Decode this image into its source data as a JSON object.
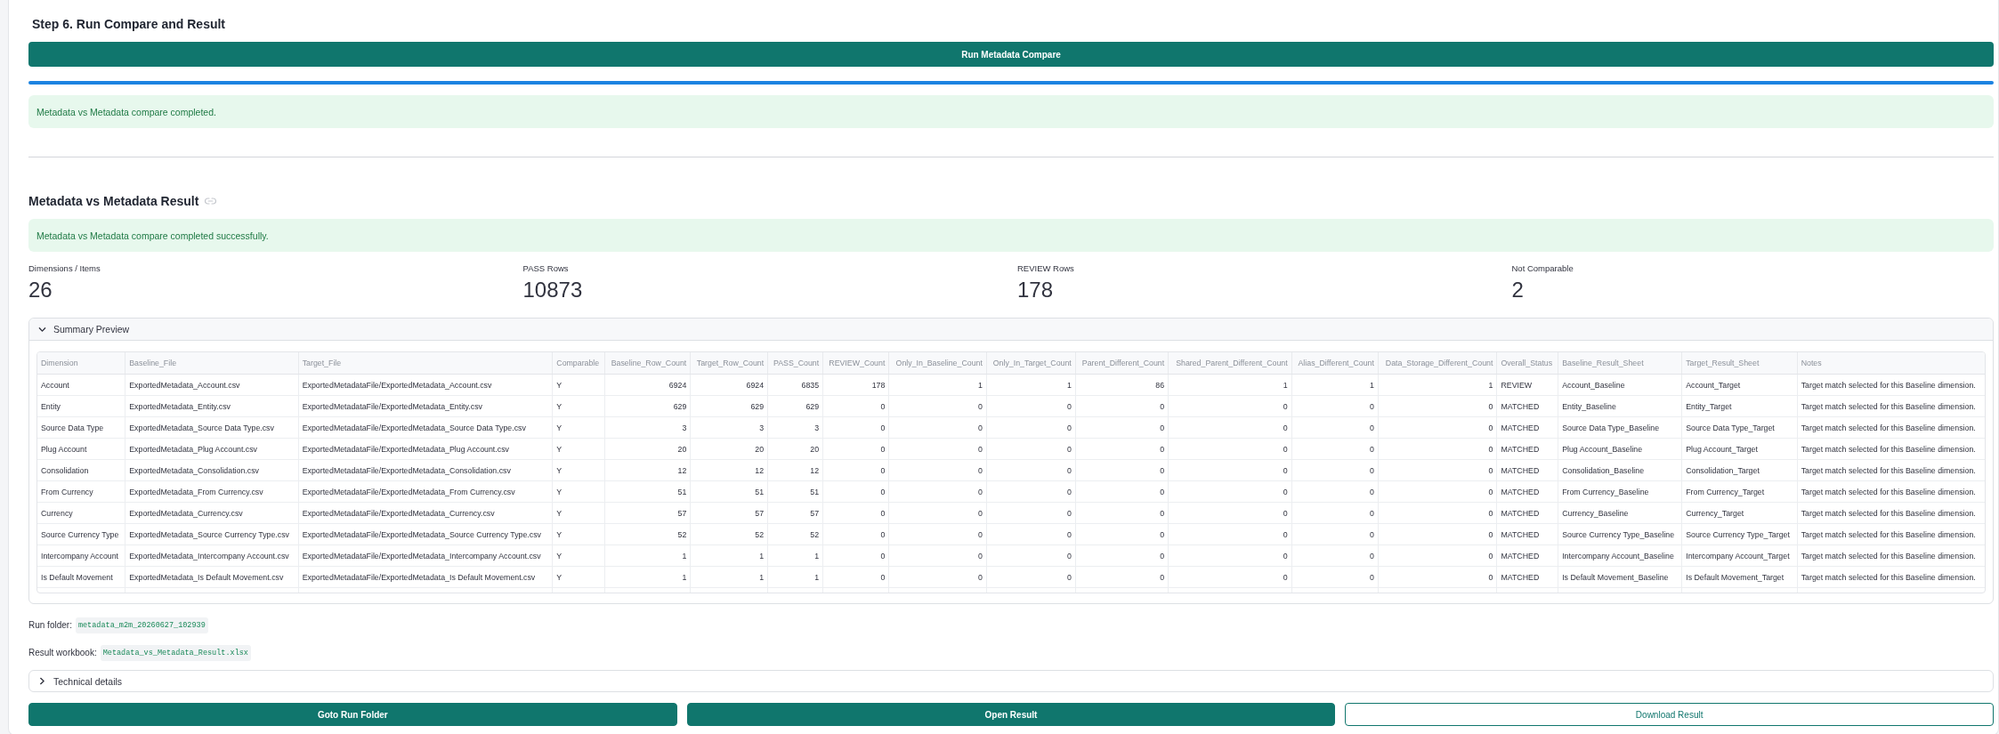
{
  "step": {
    "title": "Step 6. Run Compare and Result",
    "run_button": "Run Metadata Compare",
    "progress": {
      "level": 1.0
    },
    "status_message": "Metadata vs Metadata compare completed."
  },
  "result": {
    "heading": "Metadata vs Metadata Result",
    "success_message": "Metadata vs Metadata compare completed successfully.",
    "metrics": [
      {
        "label": "Dimensions / Items",
        "value": "26"
      },
      {
        "label": "PASS Rows",
        "value": "10873"
      },
      {
        "label": "REVIEW Rows",
        "value": "178"
      },
      {
        "label": "Not Comparable",
        "value": "2"
      }
    ],
    "summary_preview": {
      "title": "Summary Preview",
      "expanded": true,
      "table": {
        "columns": [
          {
            "label": "Dimension",
            "kind": "text"
          },
          {
            "label": "Baseline_File",
            "kind": "text"
          },
          {
            "label": "Target_File",
            "kind": "text"
          },
          {
            "label": "Comparable",
            "kind": "text"
          },
          {
            "label": "Baseline_Row_Count",
            "kind": "number"
          },
          {
            "label": "Target_Row_Count",
            "kind": "number"
          },
          {
            "label": "PASS_Count",
            "kind": "number"
          },
          {
            "label": "REVIEW_Count",
            "kind": "number"
          },
          {
            "label": "Only_In_Baseline_Count",
            "kind": "number"
          },
          {
            "label": "Only_In_Target_Count",
            "kind": "number"
          },
          {
            "label": "Parent_Different_Count",
            "kind": "number"
          },
          {
            "label": "Shared_Parent_Different_Count",
            "kind": "number"
          },
          {
            "label": "Alias_Different_Count",
            "kind": "number"
          },
          {
            "label": "Data_Storage_Different_Count",
            "kind": "number"
          },
          {
            "label": "Overall_Status",
            "kind": "text"
          },
          {
            "label": "Baseline_Result_Sheet",
            "kind": "text"
          },
          {
            "label": "Target_Result_Sheet",
            "kind": "text"
          },
          {
            "label": "Notes",
            "kind": "text"
          }
        ],
        "rows": [
          [
            "Account",
            "ExportedMetadata_Account.csv",
            "ExportedMetadataFile/ExportedMetadata_Account.csv",
            "Y",
            "6924",
            "6924",
            "6835",
            "178",
            "1",
            "1",
            "86",
            "1",
            "1",
            "1",
            "REVIEW",
            "Account_Baseline",
            "Account_Target",
            "Target match selected for this Baseline dimension."
          ],
          [
            "Entity",
            "ExportedMetadata_Entity.csv",
            "ExportedMetadataFile/ExportedMetadata_Entity.csv",
            "Y",
            "629",
            "629",
            "629",
            "0",
            "0",
            "0",
            "0",
            "0",
            "0",
            "0",
            "MATCHED",
            "Entity_Baseline",
            "Entity_Target",
            "Target match selected for this Baseline dimension."
          ],
          [
            "Source Data Type",
            "ExportedMetadata_Source Data Type.csv",
            "ExportedMetadataFile/ExportedMetadata_Source Data Type.csv",
            "Y",
            "3",
            "3",
            "3",
            "0",
            "0",
            "0",
            "0",
            "0",
            "0",
            "0",
            "MATCHED",
            "Source Data Type_Baseline",
            "Source Data Type_Target",
            "Target match selected for this Baseline dimension."
          ],
          [
            "Plug Account",
            "ExportedMetadata_Plug Account.csv",
            "ExportedMetadataFile/ExportedMetadata_Plug Account.csv",
            "Y",
            "20",
            "20",
            "20",
            "0",
            "0",
            "0",
            "0",
            "0",
            "0",
            "0",
            "MATCHED",
            "Plug Account_Baseline",
            "Plug Account_Target",
            "Target match selected for this Baseline dimension."
          ],
          [
            "Consolidation",
            "ExportedMetadata_Consolidation.csv",
            "ExportedMetadataFile/ExportedMetadata_Consolidation.csv",
            "Y",
            "12",
            "12",
            "12",
            "0",
            "0",
            "0",
            "0",
            "0",
            "0",
            "0",
            "MATCHED",
            "Consolidation_Baseline",
            "Consolidation_Target",
            "Target match selected for this Baseline dimension."
          ],
          [
            "From Currency",
            "ExportedMetadata_From Currency.csv",
            "ExportedMetadataFile/ExportedMetadata_From Currency.csv",
            "Y",
            "51",
            "51",
            "51",
            "0",
            "0",
            "0",
            "0",
            "0",
            "0",
            "0",
            "MATCHED",
            "From Currency_Baseline",
            "From Currency_Target",
            "Target match selected for this Baseline dimension."
          ],
          [
            "Currency",
            "ExportedMetadata_Currency.csv",
            "ExportedMetadataFile/ExportedMetadata_Currency.csv",
            "Y",
            "57",
            "57",
            "57",
            "0",
            "0",
            "0",
            "0",
            "0",
            "0",
            "0",
            "MATCHED",
            "Currency_Baseline",
            "Currency_Target",
            "Target match selected for this Baseline dimension."
          ],
          [
            "Source Currency Type",
            "ExportedMetadata_Source Currency Type.csv",
            "ExportedMetadataFile/ExportedMetadata_Source Currency Type.csv",
            "Y",
            "52",
            "52",
            "52",
            "0",
            "0",
            "0",
            "0",
            "0",
            "0",
            "0",
            "MATCHED",
            "Source Currency Type_Baseline",
            "Source Currency Type_Target",
            "Target match selected for this Baseline dimension."
          ],
          [
            "Intercompany Account",
            "ExportedMetadata_Intercompany Account.csv",
            "ExportedMetadataFile/ExportedMetadata_Intercompany Account.csv",
            "Y",
            "1",
            "1",
            "1",
            "0",
            "0",
            "0",
            "0",
            "0",
            "0",
            "0",
            "MATCHED",
            "Intercompany Account_Baseline",
            "Intercompany Account_Target",
            "Target match selected for this Baseline dimension."
          ],
          [
            "Is Default Movement",
            "ExportedMetadata_Is Default Movement.csv",
            "ExportedMetadataFile/ExportedMetadata_Is Default Movement.csv",
            "Y",
            "1",
            "1",
            "1",
            "0",
            "0",
            "0",
            "0",
            "0",
            "0",
            "0",
            "MATCHED",
            "Is Default Movement_Baseline",
            "Is Default Movement_Target",
            "Target match selected for this Baseline dimension."
          ]
        ]
      }
    },
    "run_folder": {
      "label": "Run folder:",
      "value": "metadata_m2m_20260627_102939"
    },
    "result_workbook": {
      "label": "Result workbook:",
      "value": "Metadata_vs_Metadata_Result.xlsx"
    },
    "technical_details": {
      "title": "Technical details",
      "expanded": false
    },
    "buttons": [
      {
        "label": "Goto Run Folder",
        "kind": "primary"
      },
      {
        "label": "Open Result",
        "kind": "primary"
      },
      {
        "label": "Download Result",
        "kind": "secondary"
      }
    ]
  }
}
